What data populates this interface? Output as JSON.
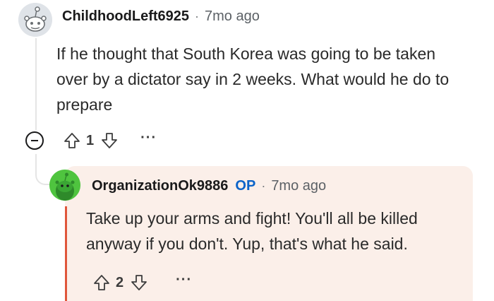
{
  "top_comment": {
    "username": "ChildhoodLeft6925",
    "separator": "·",
    "time": "7mo ago",
    "body": "If he thought that South Korea was going to be taken over by a dictator say in 2 weeks. What would he do to prepare",
    "score": "1",
    "more": "···"
  },
  "reply": {
    "username": "OrganizationOk9886",
    "badge": "OP",
    "separator": "·",
    "time": "7mo ago",
    "body": "Take up your arms and fight! You'll all be killed anyway if you don't. Yup, that's what he said.",
    "score": "2",
    "more": "···"
  },
  "colors": {
    "reply_background": "#fbefe9",
    "op_badge": "#0a63c9",
    "reply_accent_bar": "#e0563b",
    "reply_avatar": "#4fc43f",
    "top_avatar": "#dfe3e8"
  },
  "icons": {
    "collapse": "minus-circle-icon",
    "upvote": "arrow-up-icon",
    "downvote": "arrow-down-icon",
    "more": "ellipsis-icon"
  }
}
